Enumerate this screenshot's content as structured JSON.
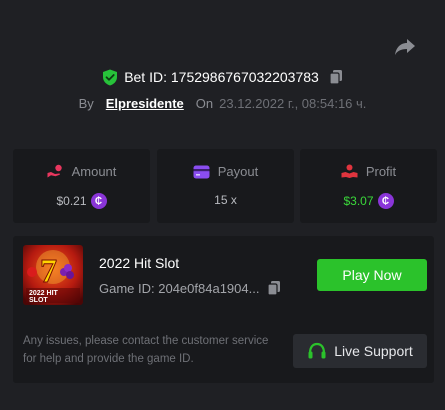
{
  "header": {
    "bet_id": "Bet ID: 1752986767032203783",
    "by_label": "By",
    "author": "Elpresidente",
    "on_label": "On",
    "datetime": "23.12.2022 г., 08:54:16 ч."
  },
  "stats": {
    "amount": {
      "label": "Amount",
      "value": "$0.21",
      "icon": "hand-coin-icon"
    },
    "payout": {
      "label": "Payout",
      "value": "15 x",
      "icon": "wallet-card-icon"
    },
    "profit": {
      "label": "Profit",
      "value": "$3.07",
      "icon": "profit-hand-icon"
    }
  },
  "game": {
    "title": "2022 Hit Slot",
    "game_id": "Game ID: 204e0f84a1904...",
    "thumb_text_line1": "2022 HIT",
    "thumb_text_line2": "SLOT",
    "play_label": "Play Now"
  },
  "support": {
    "message": "Any issues, please contact the customer service for help and provide the game ID.",
    "button_label": "Live Support"
  },
  "colors": {
    "background": "#1f2024",
    "card": "#18191c",
    "accent_green": "#2bc22b",
    "coin_purple": "#8a35d8",
    "icon_pink": "#e8365e",
    "icon_purple": "#8a4df0",
    "icon_red": "#e0343e"
  }
}
